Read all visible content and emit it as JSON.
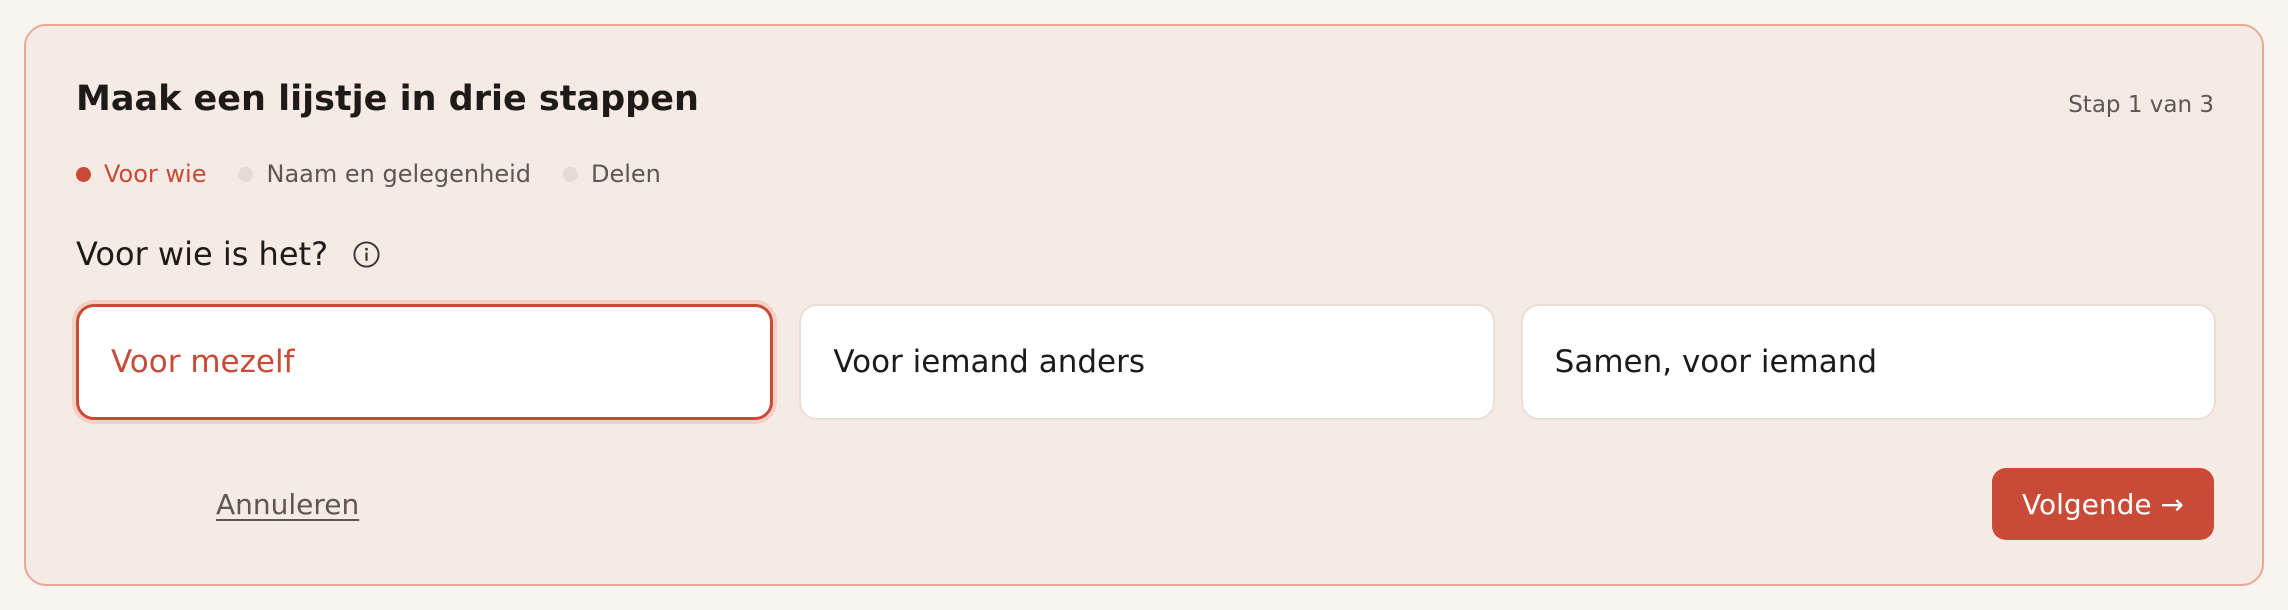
{
  "wizard": {
    "title": "Maak een lijstje in drie stappen",
    "step_counter": "Stap 1 van 3",
    "steps": [
      {
        "label": "Voor wie",
        "active": true
      },
      {
        "label": "Naam en gelegenheid",
        "active": false
      },
      {
        "label": "Delen",
        "active": false
      }
    ]
  },
  "question": {
    "label": "Voor wie is het?",
    "info_icon": "info-icon"
  },
  "options": [
    {
      "label": "Voor mezelf",
      "selected": true
    },
    {
      "label": "Voor iemand anders",
      "selected": false
    },
    {
      "label": "Samen, voor iemand",
      "selected": false
    }
  ],
  "actions": {
    "cancel_label": "Annuleren",
    "next_label": "Volgende →"
  },
  "colors": {
    "accent": "#c94b37",
    "card_background": "#f5ebe4",
    "card_border": "#e9a893",
    "inactive_dot": "#e4dbd2"
  }
}
